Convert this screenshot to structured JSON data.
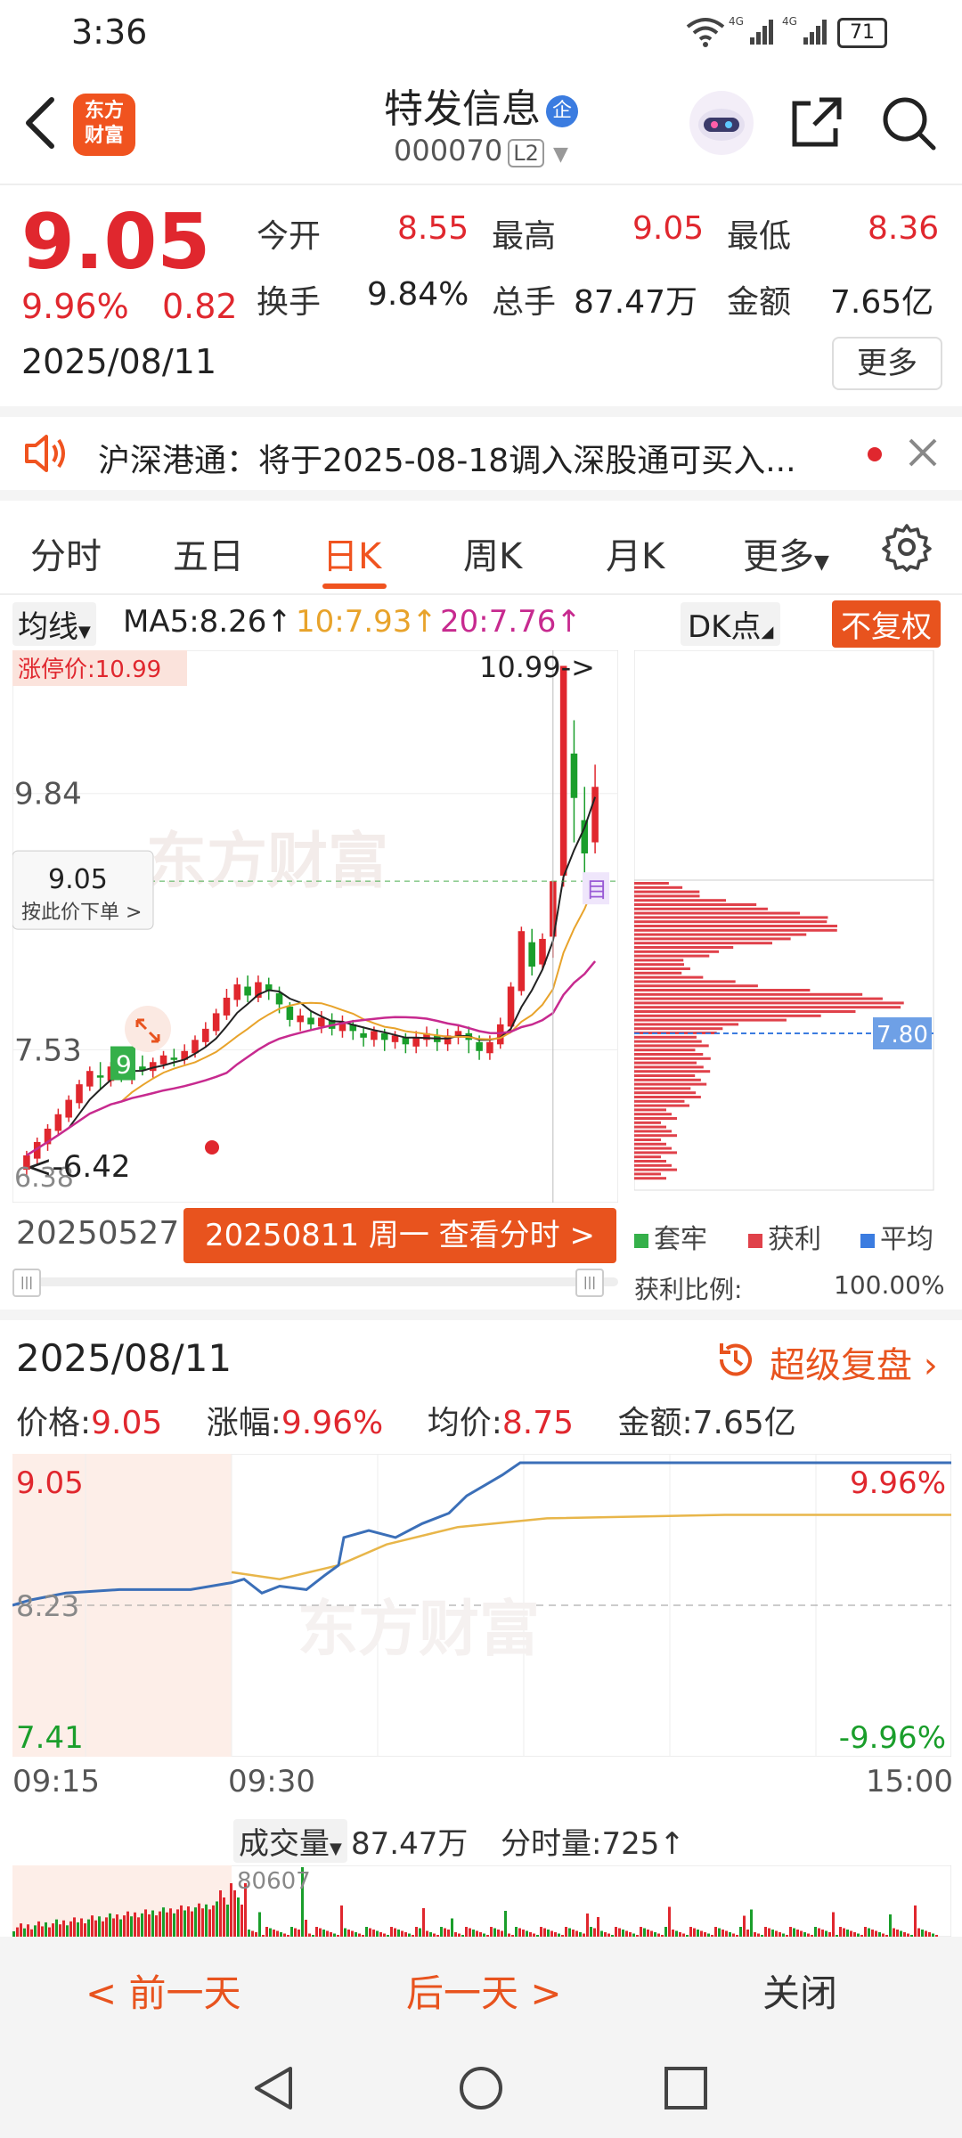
{
  "status": {
    "time": "3:36",
    "battery": "71",
    "net1": "4G",
    "net2": "4G"
  },
  "header": {
    "title": "特发信息",
    "title_badge": "企",
    "code": "000070",
    "level": "L2",
    "logo_line1": "东方",
    "logo_line2": "财富"
  },
  "quote": {
    "price": "9.05",
    "change_pct": "9.96%",
    "change": "0.82",
    "date": "2025/08/11",
    "fields": [
      {
        "label": "今开",
        "value": "8.55",
        "color": "red"
      },
      {
        "label": "最高",
        "value": "9.05",
        "color": "red"
      },
      {
        "label": "最低",
        "value": "8.36",
        "color": "red"
      },
      {
        "label": "换手",
        "value": "9.84%",
        "color": "dark"
      },
      {
        "label": "总手",
        "value": "87.47万",
        "color": "dark"
      },
      {
        "label": "金额",
        "value": "7.65亿",
        "color": "dark"
      }
    ],
    "more": "更多"
  },
  "notice": {
    "text": "沪深港通：将于2025-08-18调入深股通可买入..."
  },
  "tabs": [
    "分时",
    "五日",
    "日K",
    "周K",
    "月K",
    "更多"
  ],
  "active_tab": "日K",
  "ma": {
    "selector": "均线",
    "ma5": "MA5:8.26↑",
    "ma10": "10:7.93↑",
    "ma20": "20:7.76↑",
    "dk": "DK点",
    "fq": "不复权"
  },
  "kchart": {
    "limit_up": "涨停价:10.99",
    "limit_label": "10.99->",
    "y_labels": [
      "9.84",
      "7.53",
      "6.38"
    ],
    "low_label": "<-6.42",
    "crosshair_price": "9.05",
    "crosshair_hint": "按此价下单",
    "green_badge": "9",
    "mu": "目"
  },
  "profile": {
    "avg_label": "7.80",
    "legend": [
      "套牢",
      "获利",
      "平均"
    ],
    "ratio_label": "获利比例:",
    "ratio_value": "100.00%"
  },
  "datebar": {
    "start": "20250527",
    "button": "20250811 周一 查看分时 >"
  },
  "detail": {
    "date": "2025/08/11",
    "review": "超级复盘",
    "price_label": "价格:",
    "price": "9.05",
    "pct_label": "涨幅:",
    "pct": "9.96%",
    "avg_label": "均价:",
    "avg": "8.75",
    "amt_label": "金额:",
    "amt": "7.65亿"
  },
  "intraday": {
    "top": "9.05",
    "mid": "8.23",
    "bottom": "7.41",
    "pct_top": "9.96%",
    "pct_bottom": "-9.96%",
    "times": [
      "09:15",
      "09:30",
      "15:00"
    ]
  },
  "volume": {
    "selector": "成交量",
    "total": "87.47万",
    "tick_label": "分时量:725↑",
    "peak": "80607"
  },
  "bottom": {
    "prev": "< 前一天",
    "next": "后一天 >",
    "close": "关闭"
  },
  "colors": {
    "red": "#e0272e",
    "green": "#1a9e2b",
    "orange": "#f0531f",
    "blue": "#3b6fb8"
  }
}
